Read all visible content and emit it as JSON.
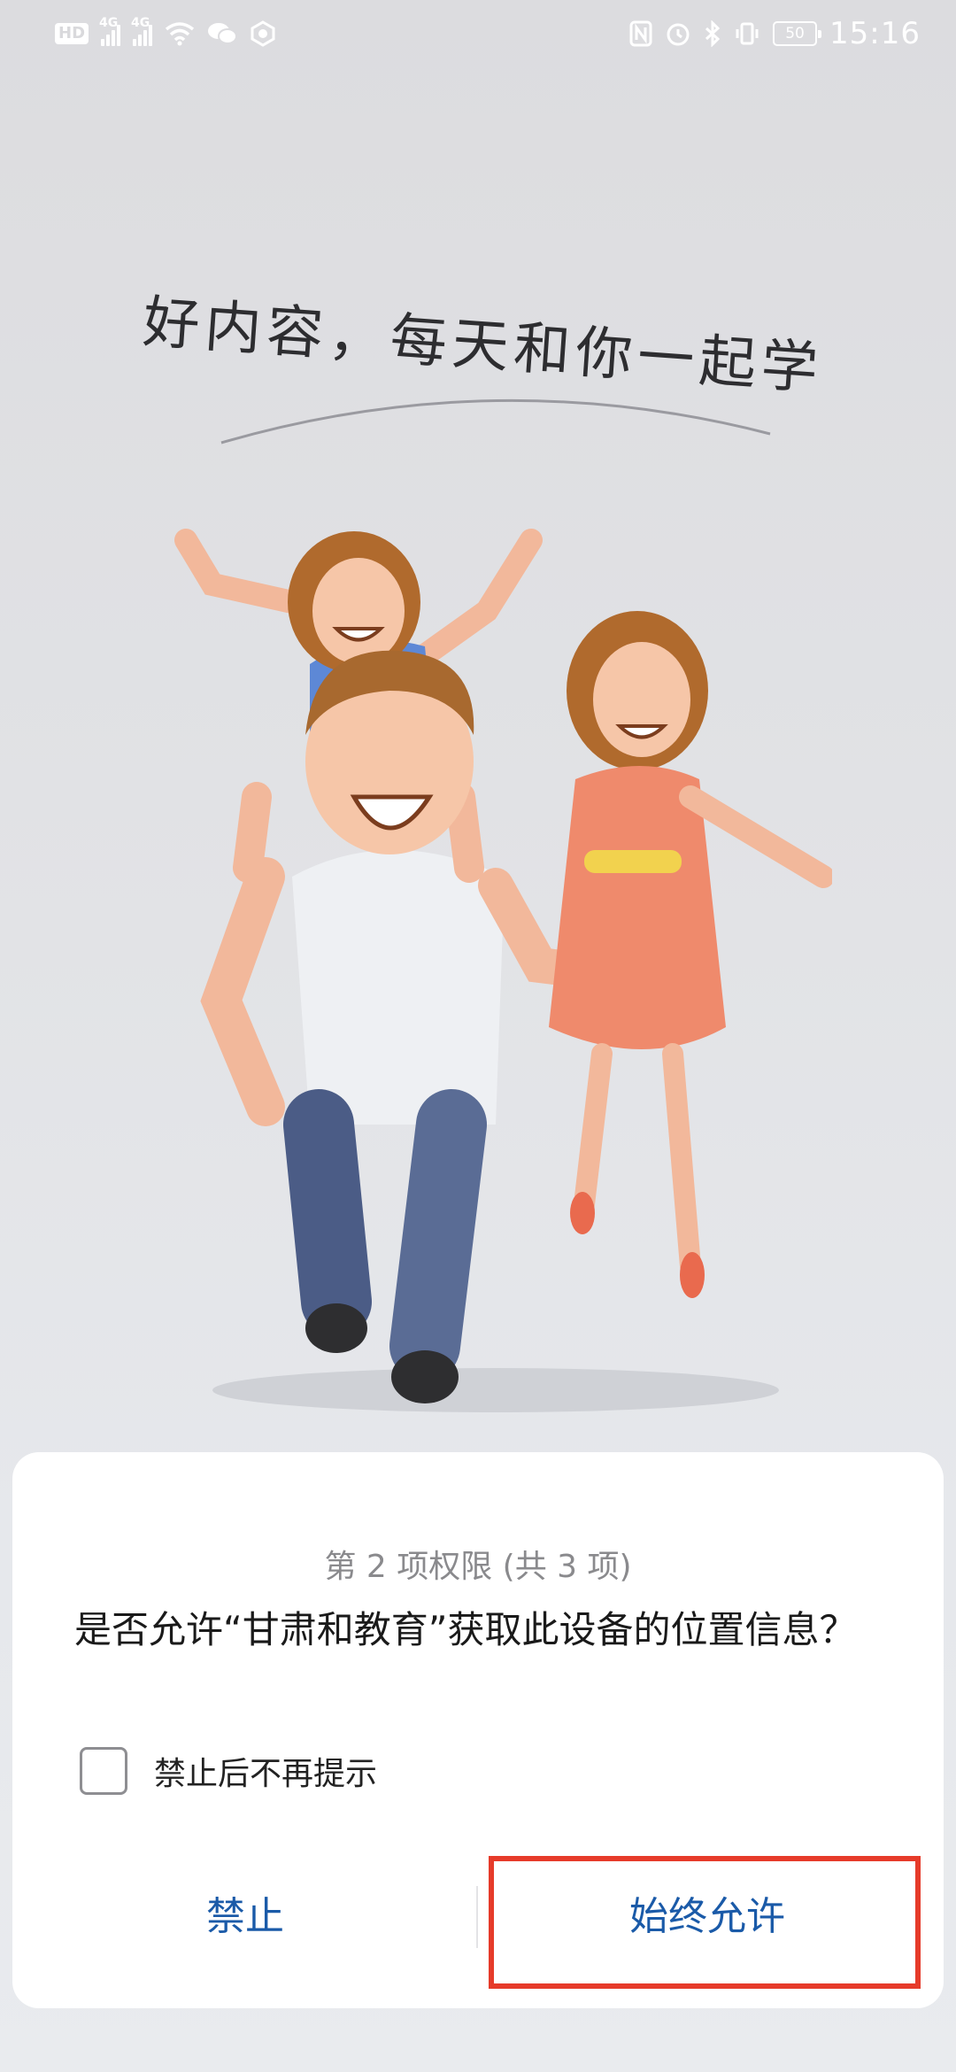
{
  "status_bar": {
    "left_badges": [
      "HD",
      "4G",
      "4G"
    ],
    "time": "15:16",
    "battery": "50",
    "icons_left": [
      "hd-icon",
      "signal-icon",
      "signal-icon",
      "wifi-icon",
      "wechat-icon",
      "app-icon"
    ],
    "icons_right": [
      "nfc-icon",
      "alarm-icon",
      "bluetooth-icon",
      "vibrate-icon",
      "battery-icon"
    ]
  },
  "splash": {
    "headline": "好内容，每天和你一起学"
  },
  "dialog": {
    "counter": "第 2 项权限 (共 3 项)",
    "question": "是否允许“甘肃和教育”获取此设备的位置信息？",
    "dont_ask_label": "禁止后不再提示",
    "deny_label": "禁止",
    "allow_label": "始终允许"
  },
  "colors": {
    "button_text": "#1a5aa8",
    "highlight": "#e63b2a"
  }
}
